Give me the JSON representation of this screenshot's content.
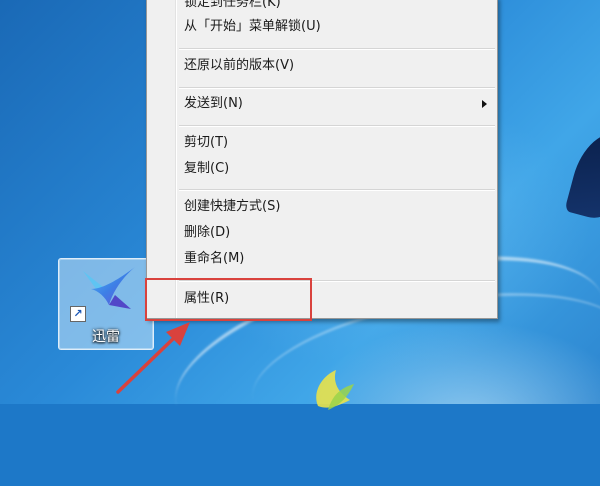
{
  "desktop": {
    "shortcut": {
      "icon": "xunlei-bird-icon",
      "overlay_icon": "shortcut-arrow-icon",
      "overlay_glyph": "↗",
      "label": "迅雷"
    }
  },
  "context_menu": {
    "items": [
      {
        "label": "锁定到任务栏(K)",
        "group": 1
      },
      {
        "label": "从「开始」菜单解锁(U)",
        "group": 1
      },
      {
        "label": "还原以前的版本(V)",
        "group": 2
      },
      {
        "label": "发送到(N)",
        "group": 3,
        "submenu": true
      },
      {
        "label": "剪切(T)",
        "group": 4
      },
      {
        "label": "复制(C)",
        "group": 4
      },
      {
        "label": "创建快捷方式(S)",
        "group": 5
      },
      {
        "label": "删除(D)",
        "group": 5
      },
      {
        "label": "重命名(M)",
        "group": 5
      },
      {
        "label": "属性(R)",
        "group": 6,
        "highlighted": true
      }
    ]
  },
  "annotation": {
    "highlight_color": "#d9423d",
    "arrow_color": "#d9423d",
    "target": "属性(R)"
  }
}
